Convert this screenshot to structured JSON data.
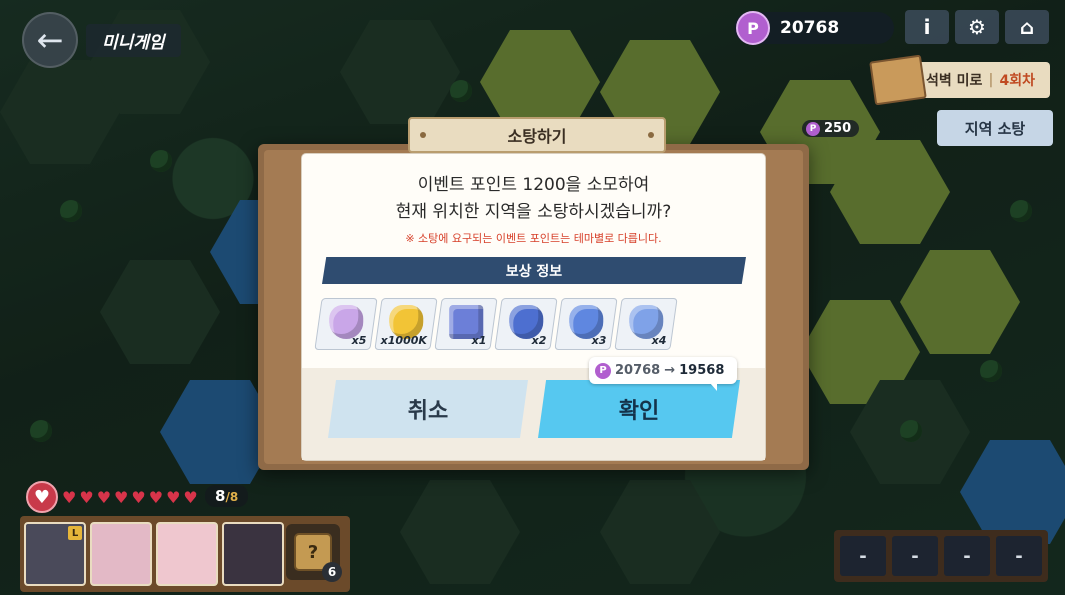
{
  "header": {
    "back_icon": "arrow-left-icon",
    "title": "미니게임",
    "points_symbol": "P",
    "points": "20768",
    "buttons": [
      {
        "icon": "info-icon",
        "glyph": "i"
      },
      {
        "icon": "gear-icon",
        "glyph": "⚙"
      },
      {
        "icon": "home-icon",
        "glyph": "⌂"
      }
    ]
  },
  "stage": {
    "name": "석벽 미로",
    "separator": "|",
    "round": "4회차"
  },
  "region_sweep_button": "지역 소탕",
  "map_cost": "250",
  "dialog": {
    "title": "소탕하기",
    "message_line1": "이벤트 포인트 1200을 소모하여",
    "message_line2": "현재 위치한 지역을 소탕하시겠습니까?",
    "note": "※ 소탕에 요구되는 이벤트 포인트는 테마별로 다릅니다.",
    "reward_header": "보상 정보",
    "rewards": [
      {
        "icon": "character-token-icon",
        "qty": "x5",
        "color": "#c9a6e8"
      },
      {
        "icon": "gold-ticket-icon",
        "qty": "x1000K",
        "color": "#f2c436"
      },
      {
        "icon": "blue-cube-icon",
        "qty": "x1",
        "color": "#6c7fd8"
      },
      {
        "icon": "blue-crystal-icon",
        "qty": "x2",
        "color": "#4d6fd0"
      },
      {
        "icon": "crystal-shard-icon",
        "qty": "x3",
        "color": "#5f87e0"
      },
      {
        "icon": "small-crystals-icon",
        "qty": "x4",
        "color": "#7fa2e8"
      }
    ],
    "cost_preview": {
      "from": "20768",
      "arrow": "→",
      "to": "19568"
    },
    "cancel_label": "취소",
    "confirm_label": "확인"
  },
  "hud": {
    "hp_current": "8",
    "hp_max": "/8",
    "hearts": 8,
    "party": [
      {
        "name": "party-member-1",
        "color": "#4a4a5a",
        "leader": "L"
      },
      {
        "name": "party-member-2",
        "color": "#e3b9c6"
      },
      {
        "name": "party-member-3",
        "color": "#efc7cf"
      },
      {
        "name": "party-member-4",
        "color": "#3a3340"
      }
    ],
    "dice_count": "6",
    "slots": [
      "-",
      "-",
      "-",
      "-"
    ]
  }
}
